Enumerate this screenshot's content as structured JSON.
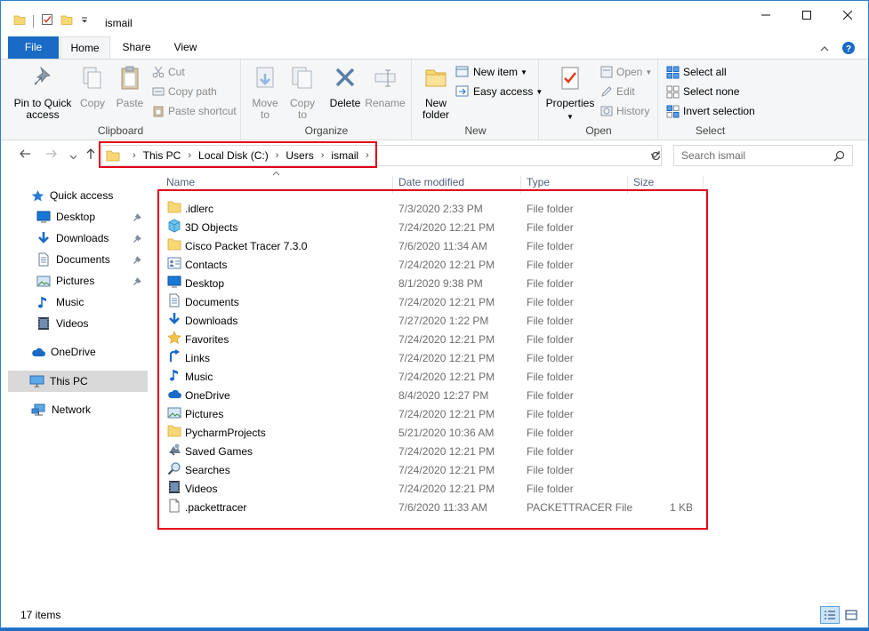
{
  "window": {
    "title": "ismail"
  },
  "tabs": [
    "File",
    "Home",
    "Share",
    "View"
  ],
  "ribbon": {
    "clipboard": {
      "label": "Clipboard",
      "pin": "Pin to Quick access",
      "copy": "Copy",
      "paste": "Paste",
      "cut": "Cut",
      "copy_path": "Copy path",
      "paste_shortcut": "Paste shortcut"
    },
    "organize": {
      "label": "Organize",
      "move_to": "Move to",
      "copy_to": "Copy to",
      "delete": "Delete",
      "rename": "Rename"
    },
    "new": {
      "label": "New",
      "new_folder": "New folder",
      "new_item": "New item",
      "easy_access": "Easy access"
    },
    "open": {
      "label": "Open",
      "properties": "Properties",
      "open": "Open",
      "edit": "Edit",
      "history": "History"
    },
    "select": {
      "label": "Select",
      "select_all": "Select all",
      "select_none": "Select none",
      "invert": "Invert selection"
    }
  },
  "address": {
    "crumbs": [
      "This PC",
      "Local Disk (C:)",
      "Users",
      "ismail"
    ]
  },
  "search": {
    "placeholder": "Search ismail"
  },
  "nav": [
    {
      "label": "Quick access",
      "icon": "star-icon"
    },
    {
      "label": "Desktop",
      "icon": "desktop-icon",
      "pinned": true
    },
    {
      "label": "Downloads",
      "icon": "download-icon",
      "pinned": true
    },
    {
      "label": "Documents",
      "icon": "documents-icon",
      "pinned": true
    },
    {
      "label": "Pictures",
      "icon": "pictures-icon",
      "pinned": true
    },
    {
      "label": "Music",
      "icon": "music-icon"
    },
    {
      "label": "Videos",
      "icon": "videos-icon"
    },
    {
      "label": "OneDrive",
      "icon": "cloud-icon"
    },
    {
      "label": "This PC",
      "icon": "computer-icon",
      "selected": true
    },
    {
      "label": "Network",
      "icon": "network-icon"
    }
  ],
  "columns": {
    "name": "Name",
    "date": "Date modified",
    "type": "Type",
    "size": "Size"
  },
  "files": [
    {
      "name": ".idlerc",
      "date": "7/3/2020 2:33 PM",
      "type": "File folder",
      "size": "",
      "icon": "folder-icon"
    },
    {
      "name": "3D Objects",
      "date": "7/24/2020 12:21 PM",
      "type": "File folder",
      "size": "",
      "icon": "3d-objects-icon"
    },
    {
      "name": "Cisco Packet Tracer 7.3.0",
      "date": "7/6/2020 11:34 AM",
      "type": "File folder",
      "size": "",
      "icon": "folder-icon"
    },
    {
      "name": "Contacts",
      "date": "7/24/2020 12:21 PM",
      "type": "File folder",
      "size": "",
      "icon": "contacts-icon"
    },
    {
      "name": "Desktop",
      "date": "8/1/2020 9:38 PM",
      "type": "File folder",
      "size": "",
      "icon": "desktop-icon"
    },
    {
      "name": "Documents",
      "date": "7/24/2020 12:21 PM",
      "type": "File folder",
      "size": "",
      "icon": "documents-icon"
    },
    {
      "name": "Downloads",
      "date": "7/27/2020 1:22 PM",
      "type": "File folder",
      "size": "",
      "icon": "download-icon"
    },
    {
      "name": "Favorites",
      "date": "7/24/2020 12:21 PM",
      "type": "File folder",
      "size": "",
      "icon": "star-icon"
    },
    {
      "name": "Links",
      "date": "7/24/2020 12:21 PM",
      "type": "File folder",
      "size": "",
      "icon": "links-icon"
    },
    {
      "name": "Music",
      "date": "7/24/2020 12:21 PM",
      "type": "File folder",
      "size": "",
      "icon": "music-icon"
    },
    {
      "name": "OneDrive",
      "date": "8/4/2020 12:27 PM",
      "type": "File folder",
      "size": "",
      "icon": "cloud-icon"
    },
    {
      "name": "Pictures",
      "date": "7/24/2020 12:21 PM",
      "type": "File folder",
      "size": "",
      "icon": "pictures-icon"
    },
    {
      "name": "PycharmProjects",
      "date": "5/21/2020 10:36 AM",
      "type": "File folder",
      "size": "",
      "icon": "folder-icon"
    },
    {
      "name": "Saved Games",
      "date": "7/24/2020 12:21 PM",
      "type": "File folder",
      "size": "",
      "icon": "saved-games-icon"
    },
    {
      "name": "Searches",
      "date": "7/24/2020 12:21 PM",
      "type": "File folder",
      "size": "",
      "icon": "search-icon"
    },
    {
      "name": "Videos",
      "date": "7/24/2020 12:21 PM",
      "type": "File folder",
      "size": "",
      "icon": "videos-icon"
    },
    {
      "name": ".packettracer",
      "date": "7/6/2020 11:33 AM",
      "type": "PACKETTRACER File",
      "size": "1 KB",
      "icon": "file-icon"
    }
  ],
  "status": {
    "items": "17 items"
  },
  "colors": {
    "accent": "#1a6bc6",
    "highlight": "#e3001b",
    "folder": "#f8d775"
  }
}
